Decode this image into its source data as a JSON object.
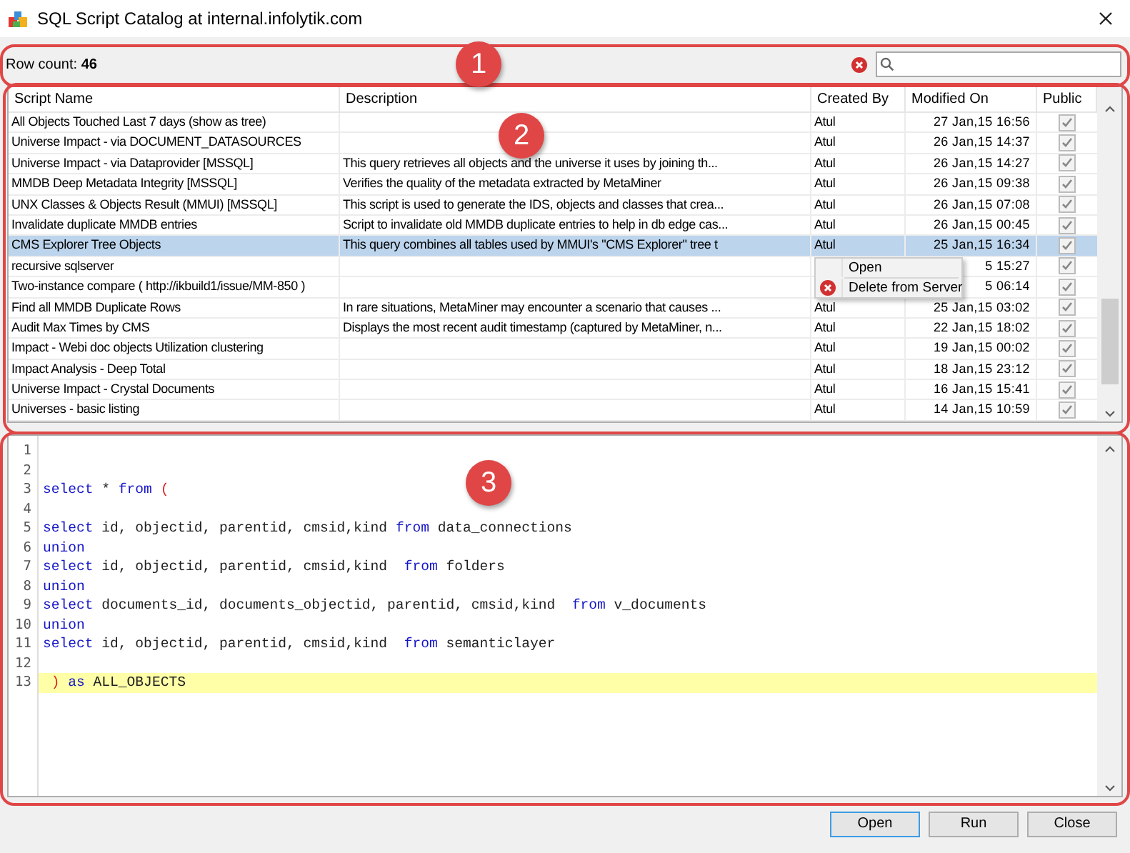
{
  "window": {
    "title": "SQL Script Catalog at internal.infolytik.com"
  },
  "toolbar": {
    "row_count_label": "Row count:",
    "row_count": "46"
  },
  "table": {
    "columns": [
      "Script Name",
      "Description",
      "Created By",
      "Modified On",
      "Public"
    ],
    "rows": [
      {
        "name": "All Objects Touched Last 7 days (show as tree)",
        "created_by": "Atul",
        "modified": "27  Jan,15  16:56",
        "public": true,
        "selected": false
      },
      {
        "name": "Universe Impact - via DOCUMENT_DATASOURCES",
        "created_by": "Atul",
        "modified": "26  Jan,15  14:37",
        "public": true,
        "selected": false
      },
      {
        "name": "Universe Impact - via Dataprovider [MSSQL]",
        "description": "This query retrieves all objects and the universe it uses by joining th...",
        "created_by": "Atul",
        "modified": "26  Jan,15  14:27",
        "public": true,
        "selected": false
      },
      {
        "name": "MMDB Deep Metadata Integrity [MSSQL]",
        "description": "Verifies the quality of the metadata extracted by MetaMiner",
        "created_by": "Atul",
        "modified": "26  Jan,15  09:38",
        "public": true,
        "selected": false
      },
      {
        "name": "UNX Classes & Objects Result (MMUI) [MSSQL]",
        "description": "This script is used to generate the IDS, objects and classes that crea...",
        "created_by": "Atul",
        "modified": "26  Jan,15  07:08",
        "public": true,
        "selected": false
      },
      {
        "name": "Invalidate duplicate MMDB entries",
        "description": "Script to invalidate old MMDB duplicate entries to help in db edge cas...",
        "created_by": "Atul",
        "modified": "26  Jan,15  00:45",
        "public": true,
        "selected": false
      },
      {
        "name": "CMS Explorer Tree Objects",
        "description": "This query combines all tables used by MMUI's \"CMS Explorer\" tree t",
        "created_by": "Atul",
        "modified": "25  Jan,15  16:34",
        "public": true,
        "selected": true
      },
      {
        "name": "recursive sqlserver",
        "modified": "5  15:27",
        "public": true,
        "selected": false
      },
      {
        "name": "Two-instance compare ( http://ikbuild1/issue/MM-850 )",
        "modified": "5  06:14",
        "public": true,
        "selected": false
      },
      {
        "name": "Find all MMDB Duplicate Rows",
        "description": "In rare situations, MetaMiner may encounter a scenario that causes ...",
        "created_by": "Atul",
        "modified": "25  Jan,15  03:02",
        "public": true,
        "selected": false
      },
      {
        "name": "Audit Max Times by CMS",
        "description": "Displays the most recent audit timestamp (captured by MetaMiner, n...",
        "created_by": "Atul",
        "modified": "22  Jan,15  18:02",
        "public": true,
        "selected": false
      },
      {
        "name": "Impact - Webi doc objects Utilization clustering",
        "created_by": "Atul",
        "modified": "19  Jan,15  00:02",
        "public": true,
        "selected": false
      },
      {
        "name": "Impact Analysis - Deep Total",
        "created_by": "Atul",
        "modified": "18  Jan,15  23:12",
        "public": true,
        "selected": false
      },
      {
        "name": "Universe Impact - Crystal Documents",
        "created_by": "Atul",
        "modified": "16  Jan,15  15:41",
        "public": true,
        "selected": false
      },
      {
        "name": "Universes - basic listing",
        "created_by": "Atul",
        "modified": "14  Jan,15  10:59",
        "public": true,
        "selected": false
      }
    ]
  },
  "context_menu": {
    "items": [
      {
        "label": "Open",
        "kind": "plain"
      },
      {
        "label": "Delete from Server",
        "kind": "delete"
      }
    ]
  },
  "editor": {
    "lines": [
      {
        "number": "1",
        "current": false
      },
      {
        "number": "2",
        "current": false
      },
      {
        "number": "3",
        "current": false,
        "tokens": [
          {
            "kind": "keyword",
            "text": "select"
          },
          {
            "kind": "plain",
            "text": " * "
          },
          {
            "kind": "keyword",
            "text": "from"
          },
          {
            "kind": "paren",
            "text": " ("
          }
        ]
      },
      {
        "number": "4",
        "current": false
      },
      {
        "number": "5",
        "current": false,
        "tokens": [
          {
            "kind": "keyword",
            "text": "select"
          },
          {
            "kind": "plain",
            "text": " id, objectid, parentid, cmsid,kind "
          },
          {
            "kind": "keyword",
            "text": "from"
          },
          {
            "kind": "plain",
            "text": " data_connections"
          }
        ]
      },
      {
        "number": "6",
        "current": false,
        "tokens": [
          {
            "kind": "keyword",
            "text": "union"
          }
        ]
      },
      {
        "number": "7",
        "current": false,
        "tokens": [
          {
            "kind": "keyword",
            "text": "select"
          },
          {
            "kind": "plain",
            "text": " id, objectid, parentid, cmsid,kind  "
          },
          {
            "kind": "keyword",
            "text": "from"
          },
          {
            "kind": "plain",
            "text": " folders"
          }
        ]
      },
      {
        "number": "8",
        "current": false,
        "tokens": [
          {
            "kind": "keyword",
            "text": "union"
          }
        ]
      },
      {
        "number": "9",
        "current": false,
        "tokens": [
          {
            "kind": "keyword",
            "text": "select"
          },
          {
            "kind": "plain",
            "text": " documents_id, documents_objectid, parentid, cmsid,kind  "
          },
          {
            "kind": "keyword",
            "text": "from"
          },
          {
            "kind": "plain",
            "text": " v_documents"
          }
        ]
      },
      {
        "number": "10",
        "current": false,
        "tokens": [
          {
            "kind": "keyword",
            "text": "union"
          }
        ]
      },
      {
        "number": "11",
        "current": false,
        "tokens": [
          {
            "kind": "keyword",
            "text": "select"
          },
          {
            "kind": "plain",
            "text": " id, objectid, parentid, cmsid,kind  "
          },
          {
            "kind": "keyword",
            "text": "from"
          },
          {
            "kind": "plain",
            "text": " semanticlayer"
          }
        ]
      },
      {
        "number": "12",
        "current": false
      },
      {
        "number": "13",
        "current": true,
        "tokens": [
          {
            "kind": "paren",
            "text": " )"
          },
          {
            "kind": "keyword",
            "text": " as"
          },
          {
            "kind": "plain",
            "text": " ALL_OBJECTS"
          }
        ]
      }
    ]
  },
  "buttons": [
    {
      "label": "Open",
      "selected": true
    },
    {
      "label": "Run",
      "selected": false
    },
    {
      "label": "Close",
      "selected": false
    }
  ],
  "annotations": [
    {
      "label": "1"
    },
    {
      "label": "2"
    },
    {
      "label": "3"
    }
  ]
}
